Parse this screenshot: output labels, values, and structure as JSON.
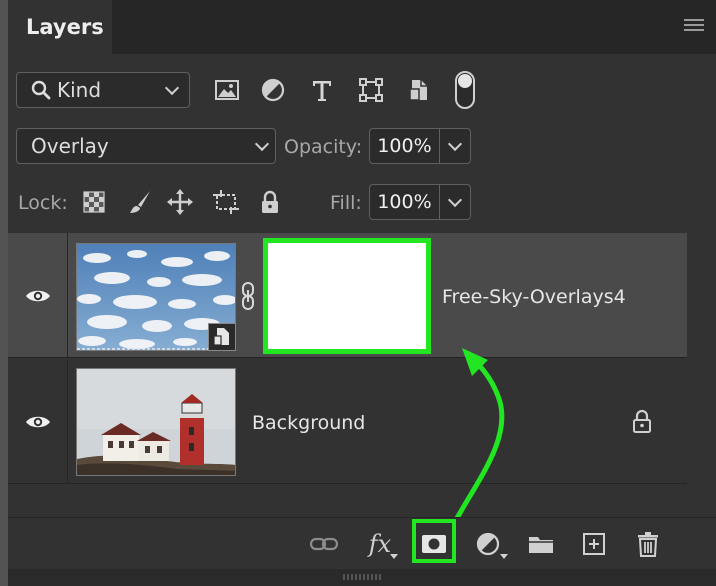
{
  "panel": {
    "tab_title": "Layers",
    "menu_icon": "panel-menu-icon"
  },
  "filter": {
    "kind_label": "Kind",
    "filter_icons": [
      "image-filter-icon",
      "adjustment-filter-icon",
      "type-filter-icon",
      "shape-filter-icon",
      "smart-object-filter-icon"
    ],
    "toggle_icon": "filter-toggle-icon"
  },
  "blend": {
    "mode": "Overlay",
    "opacity_label": "Opacity:",
    "opacity_value": "100%"
  },
  "lock": {
    "label": "Lock:",
    "icons": [
      "lock-transparent-pixels-icon",
      "lock-image-pixels-icon",
      "lock-position-icon",
      "lock-artboard-icon",
      "lock-all-icon"
    ],
    "fill_label": "Fill:",
    "fill_value": "100%"
  },
  "layers": [
    {
      "name": "Free-Sky-Overlays4",
      "selected": true,
      "visible": true,
      "has_mask": true,
      "linked": true,
      "smart_object": true
    },
    {
      "name": "Background",
      "selected": false,
      "visible": true,
      "locked": true
    }
  ],
  "bottom_toolbar": {
    "buttons": [
      "link-layers-icon",
      "fx-icon",
      "add-mask-icon",
      "adjustment-layer-icon",
      "group-folder-icon",
      "new-layer-icon",
      "delete-icon"
    ],
    "fx_label": "fx"
  },
  "annotations": {
    "highlight_color": "#22e622"
  },
  "colors": {
    "panel_bg": "#323232",
    "selected_row": "#4a4a4a",
    "accent_green": "#22e622"
  }
}
